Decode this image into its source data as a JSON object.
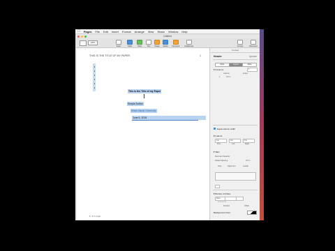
{
  "menubar": {
    "apple": "",
    "app": "Pages",
    "items": [
      "File",
      "Edit",
      "Insert",
      "Format",
      "Arrange",
      "View",
      "Share",
      "Window",
      "Help"
    ]
  },
  "window": {
    "title": "Untitled"
  },
  "toolbar": {
    "view_label": "View",
    "zoom_value": "125%",
    "zoom_label": "Zoom",
    "buttons": [
      "Insert",
      "Table",
      "Chart",
      "Text",
      "Shape",
      "Media",
      "Comment",
      "Collaborate"
    ],
    "right_buttons": [
      "Format",
      "Document"
    ]
  },
  "document": {
    "header_left": "THIS IS THE TITLE OF MY PAPER",
    "header_right": "1",
    "title_line": "This is the Title of my Paper",
    "author_line": "Simple Author",
    "institution_line": "Mises Name University",
    "date_line": "June 6, 2018",
    "footer_page": "1",
    "footer_text": "of 1 page"
  },
  "inspector": {
    "tabs": [
      "Format",
      "Arrange"
    ],
    "title": "Header",
    "title_right": "Update",
    "segments": [
      "Style",
      "Layout",
      "More"
    ],
    "segment_active": 1,
    "columns_label": "Columns",
    "columns_value": "1",
    "column_header": "Column",
    "gutter_header": "Gutter",
    "column_row_value": "1",
    "gutter_row_value": "0.5 in",
    "equal_width_label": "Equal column width",
    "indents_label": "Indents",
    "first_label": "First",
    "left_label": "Left",
    "right_label": "Right",
    "first_value": "0 in",
    "left_value": "0 in",
    "right_value": "0 in",
    "tabs_label": "Tabs",
    "decimal_label": "Decimal Character",
    "decimal_value": ".",
    "default_spacing_label": "Default Spacing",
    "default_spacing_value": "0.5 in",
    "tab_stops": [
      "Stop",
      "Alignment",
      "Leader"
    ],
    "borders_label": "Borders & Rules",
    "border_style": "None",
    "position_label": "Position",
    "offset_label": "Offset",
    "background_label": "Background Color"
  }
}
